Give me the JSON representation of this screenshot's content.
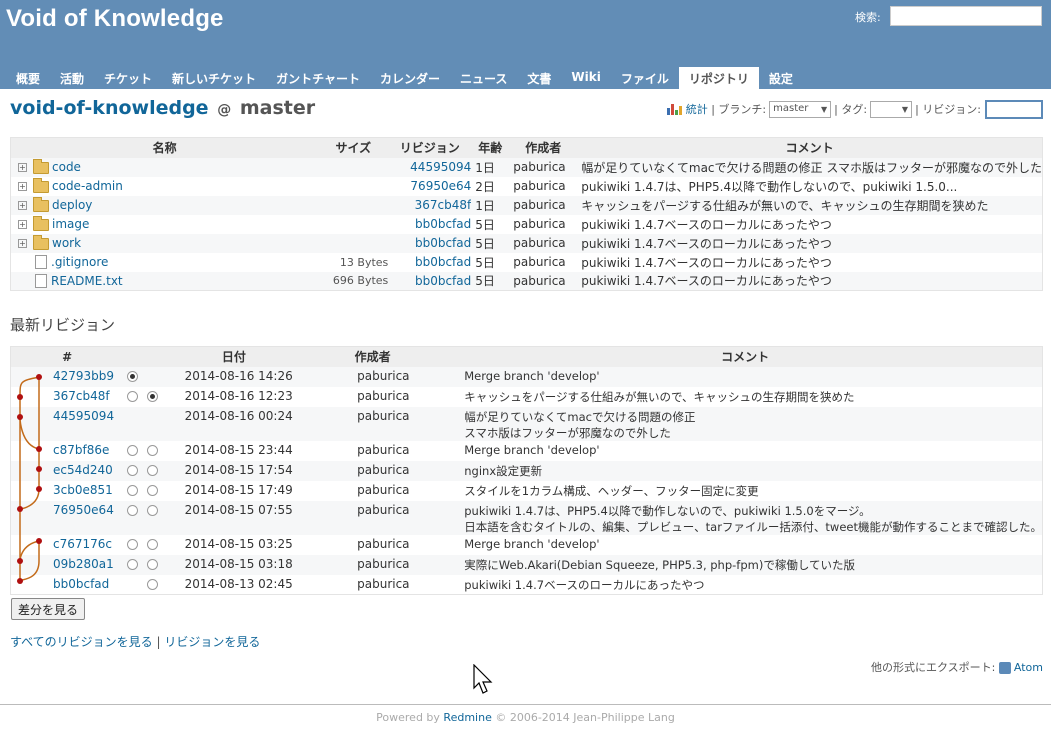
{
  "header": {
    "title": "Void of Knowledge",
    "search_label": "検索:",
    "search_value": ""
  },
  "menu": [
    {
      "label": "概要"
    },
    {
      "label": "活動"
    },
    {
      "label": "チケット"
    },
    {
      "label": "新しいチケット"
    },
    {
      "label": "ガントチャート"
    },
    {
      "label": "カレンダー"
    },
    {
      "label": "ニュース"
    },
    {
      "label": "文書"
    },
    {
      "label": "Wiki"
    },
    {
      "label": "ファイル"
    },
    {
      "label": "リポジトリ",
      "selected": true
    },
    {
      "label": "設定"
    }
  ],
  "page_title": {
    "repo": "void-of-knowledge",
    "at": "@",
    "branch": "master"
  },
  "toolbar": {
    "stats_label": "統計",
    "branch_label": "| ブランチ:",
    "branch_value": "master",
    "tag_label": "| タグ:",
    "tag_value": "",
    "revision_label": "| リビジョン:",
    "revision_value": ""
  },
  "entries": {
    "headers": {
      "name": "名称",
      "size": "サイズ",
      "revision": "リビジョン",
      "age": "年齢",
      "author": "作成者",
      "comment": "コメント"
    },
    "rows": [
      {
        "type": "dir",
        "name": "code",
        "size": "",
        "revision": "44595094",
        "age": "1日",
        "author": "paburica",
        "comment": "幅が足りていなくてmacで欠ける問題の修正 スマホ版はフッターが邪魔なので外した"
      },
      {
        "type": "dir",
        "name": "code-admin",
        "size": "",
        "revision": "76950e64",
        "age": "2日",
        "author": "paburica",
        "comment": "pukiwiki 1.4.7は、PHP5.4以降で動作しないので、pukiwiki 1.5.0..."
      },
      {
        "type": "dir",
        "name": "deploy",
        "size": "",
        "revision": "367cb48f",
        "age": "1日",
        "author": "paburica",
        "comment": "キャッシュをパージする仕組みが無いので、キャッシュの生存期間を狭めた"
      },
      {
        "type": "dir",
        "name": "image",
        "size": "",
        "revision": "bb0bcfad",
        "age": "5日",
        "author": "paburica",
        "comment": "pukiwiki 1.4.7ベースのローカルにあったやつ"
      },
      {
        "type": "dir",
        "name": "work",
        "size": "",
        "revision": "bb0bcfad",
        "age": "5日",
        "author": "paburica",
        "comment": "pukiwiki 1.4.7ベースのローカルにあったやつ"
      },
      {
        "type": "file",
        "name": ".gitignore",
        "size": "13 Bytes",
        "revision": "bb0bcfad",
        "age": "5日",
        "author": "paburica",
        "comment": "pukiwiki 1.4.7ベースのローカルにあったやつ"
      },
      {
        "type": "file",
        "name": "README.txt",
        "size": "696 Bytes",
        "revision": "bb0bcfad",
        "age": "5日",
        "author": "paburica",
        "comment": "pukiwiki 1.4.7ベースのローカルにあったやつ"
      }
    ]
  },
  "latest": {
    "title": "最新リビジョン",
    "headers": {
      "num": "#",
      "date": "日付",
      "author": "作成者",
      "comment": "コメント"
    },
    "rows": [
      {
        "rev": "42793bb9",
        "radio1": "checked",
        "radio2": "",
        "date": "2014-08-16 14:26",
        "author": "paburica",
        "comment": [
          "Merge branch 'develop'"
        ]
      },
      {
        "rev": "367cb48f",
        "radio1": "off",
        "radio2": "checked",
        "date": "2014-08-16 12:23",
        "author": "paburica",
        "comment": [
          "キャッシュをパージする仕組みが無いので、キャッシュの生存期間を狭めた"
        ]
      },
      {
        "rev": "44595094",
        "radio1": "",
        "radio2": "",
        "date": "2014-08-16 00:24",
        "author": "paburica",
        "comment": [
          "幅が足りていなくてmacで欠ける問題の修正",
          "スマホ版はフッターが邪魔なので外した"
        ]
      },
      {
        "rev": "c87bf86e",
        "radio1": "off",
        "radio2": "off",
        "date": "2014-08-15 23:44",
        "author": "paburica",
        "comment": [
          "Merge branch 'develop'"
        ]
      },
      {
        "rev": "ec54d240",
        "radio1": "off",
        "radio2": "off",
        "date": "2014-08-15 17:54",
        "author": "paburica",
        "comment": [
          "nginx設定更新"
        ]
      },
      {
        "rev": "3cb0e851",
        "radio1": "off",
        "radio2": "off",
        "date": "2014-08-15 17:49",
        "author": "paburica",
        "comment": [
          "スタイルを1カラム構成、ヘッダー、フッター固定に変更"
        ]
      },
      {
        "rev": "76950e64",
        "radio1": "off",
        "radio2": "off",
        "date": "2014-08-15 07:55",
        "author": "paburica",
        "comment": [
          "pukiwiki 1.4.7は、PHP5.4以降で動作しないので、pukiwiki 1.5.0をマージ。",
          "日本語を含むタイトルの、編集、プレビュー、tarファイルー括添付、tweet機能が動作することまで確認した。"
        ]
      },
      {
        "rev": "c767176c",
        "radio1": "off",
        "radio2": "off",
        "date": "2014-08-15 03:25",
        "author": "paburica",
        "comment": [
          "Merge branch 'develop'"
        ]
      },
      {
        "rev": "09b280a1",
        "radio1": "off",
        "radio2": "off",
        "date": "2014-08-15 03:18",
        "author": "paburica",
        "comment": [
          "実際にWeb.Akari(Debian Squeeze, PHP5.3, php-fpm)で稼働していた版"
        ]
      },
      {
        "rev": "bb0bcfad",
        "radio1": "",
        "radio2": "off",
        "date": "2014-08-13 02:45",
        "author": "paburica",
        "comment": [
          "pukiwiki 1.4.7ベースのローカルにあったやつ"
        ]
      }
    ]
  },
  "diff_button": "差分を見る",
  "links": {
    "all_revisions": "すべてのリビジョンを見る",
    "separator": "|",
    "view_revisions": "リビジョンを見る"
  },
  "export": {
    "label": "他の形式にエクスポート:",
    "atom": "Atom"
  },
  "footer": {
    "powered_by": "Powered by",
    "redmine": "Redmine",
    "copyright": "© 2006-2014 Jean-Philippe Lang"
  },
  "colors": {
    "header_bg": "#628db6",
    "link": "#169",
    "graph_line": "#c36b1a",
    "graph_node": "#b01010"
  }
}
